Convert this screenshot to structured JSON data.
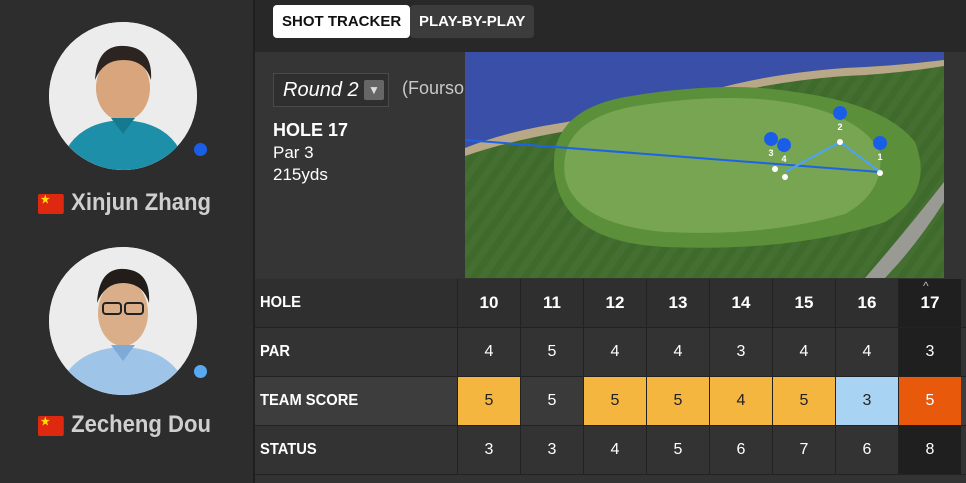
{
  "players": [
    {
      "name": "Xinjun Zhang",
      "country": "China",
      "flag_icon": "china-flag-icon",
      "status_color": "#1a5ee8"
    },
    {
      "name": "Zecheng Dou",
      "country": "China",
      "flag_icon": "china-flag-icon",
      "status_color": "#59a9f0"
    }
  ],
  "tabs": {
    "shot_tracker": "SHOT TRACKER",
    "play_by_play": "PLAY-BY-PLAY"
  },
  "round": {
    "selected": "Round 2",
    "format": "(Foursomes)"
  },
  "hole_info": {
    "title": "HOLE 17",
    "par": "Par 3",
    "yardage": "215yds"
  },
  "shot_markers": [
    "1",
    "2",
    "3",
    "4"
  ],
  "scorecard": {
    "row_labels": {
      "hole": "HOLE",
      "par": "PAR",
      "team_score": "TEAM SCORE",
      "status": "STATUS"
    },
    "holes": [
      "10",
      "11",
      "12",
      "13",
      "14",
      "15",
      "16",
      "17"
    ],
    "par": [
      "4",
      "5",
      "4",
      "4",
      "3",
      "4",
      "4",
      "3"
    ],
    "team_score": [
      "5",
      "5",
      "5",
      "5",
      "4",
      "5",
      "3",
      "5"
    ],
    "status": [
      "3",
      "3",
      "4",
      "5",
      "6",
      "7",
      "6",
      "8"
    ],
    "score_colors": [
      "#f5b63f",
      "#3a3a3a",
      "#f5b63f",
      "#f5b63f",
      "#f5b63f",
      "#f5b63f",
      "#a8d3f2",
      "#e8590c"
    ],
    "current_hole": "17"
  }
}
